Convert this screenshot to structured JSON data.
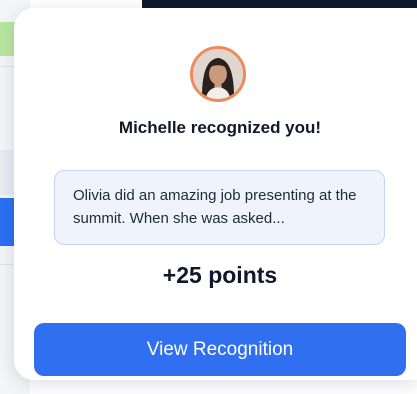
{
  "notification": {
    "avatar_alt": "Michelle",
    "title": "Michelle recognized you!",
    "message": "Olivia did an amazing job presenting at the summit. When she was asked...",
    "points": "+25 points",
    "cta_label": "View Recognition"
  },
  "colors": {
    "accent": "#2f6ff0",
    "avatar_ring": "#f08a5a",
    "message_bg": "#eef3fc",
    "message_border": "#c6d5f0"
  }
}
